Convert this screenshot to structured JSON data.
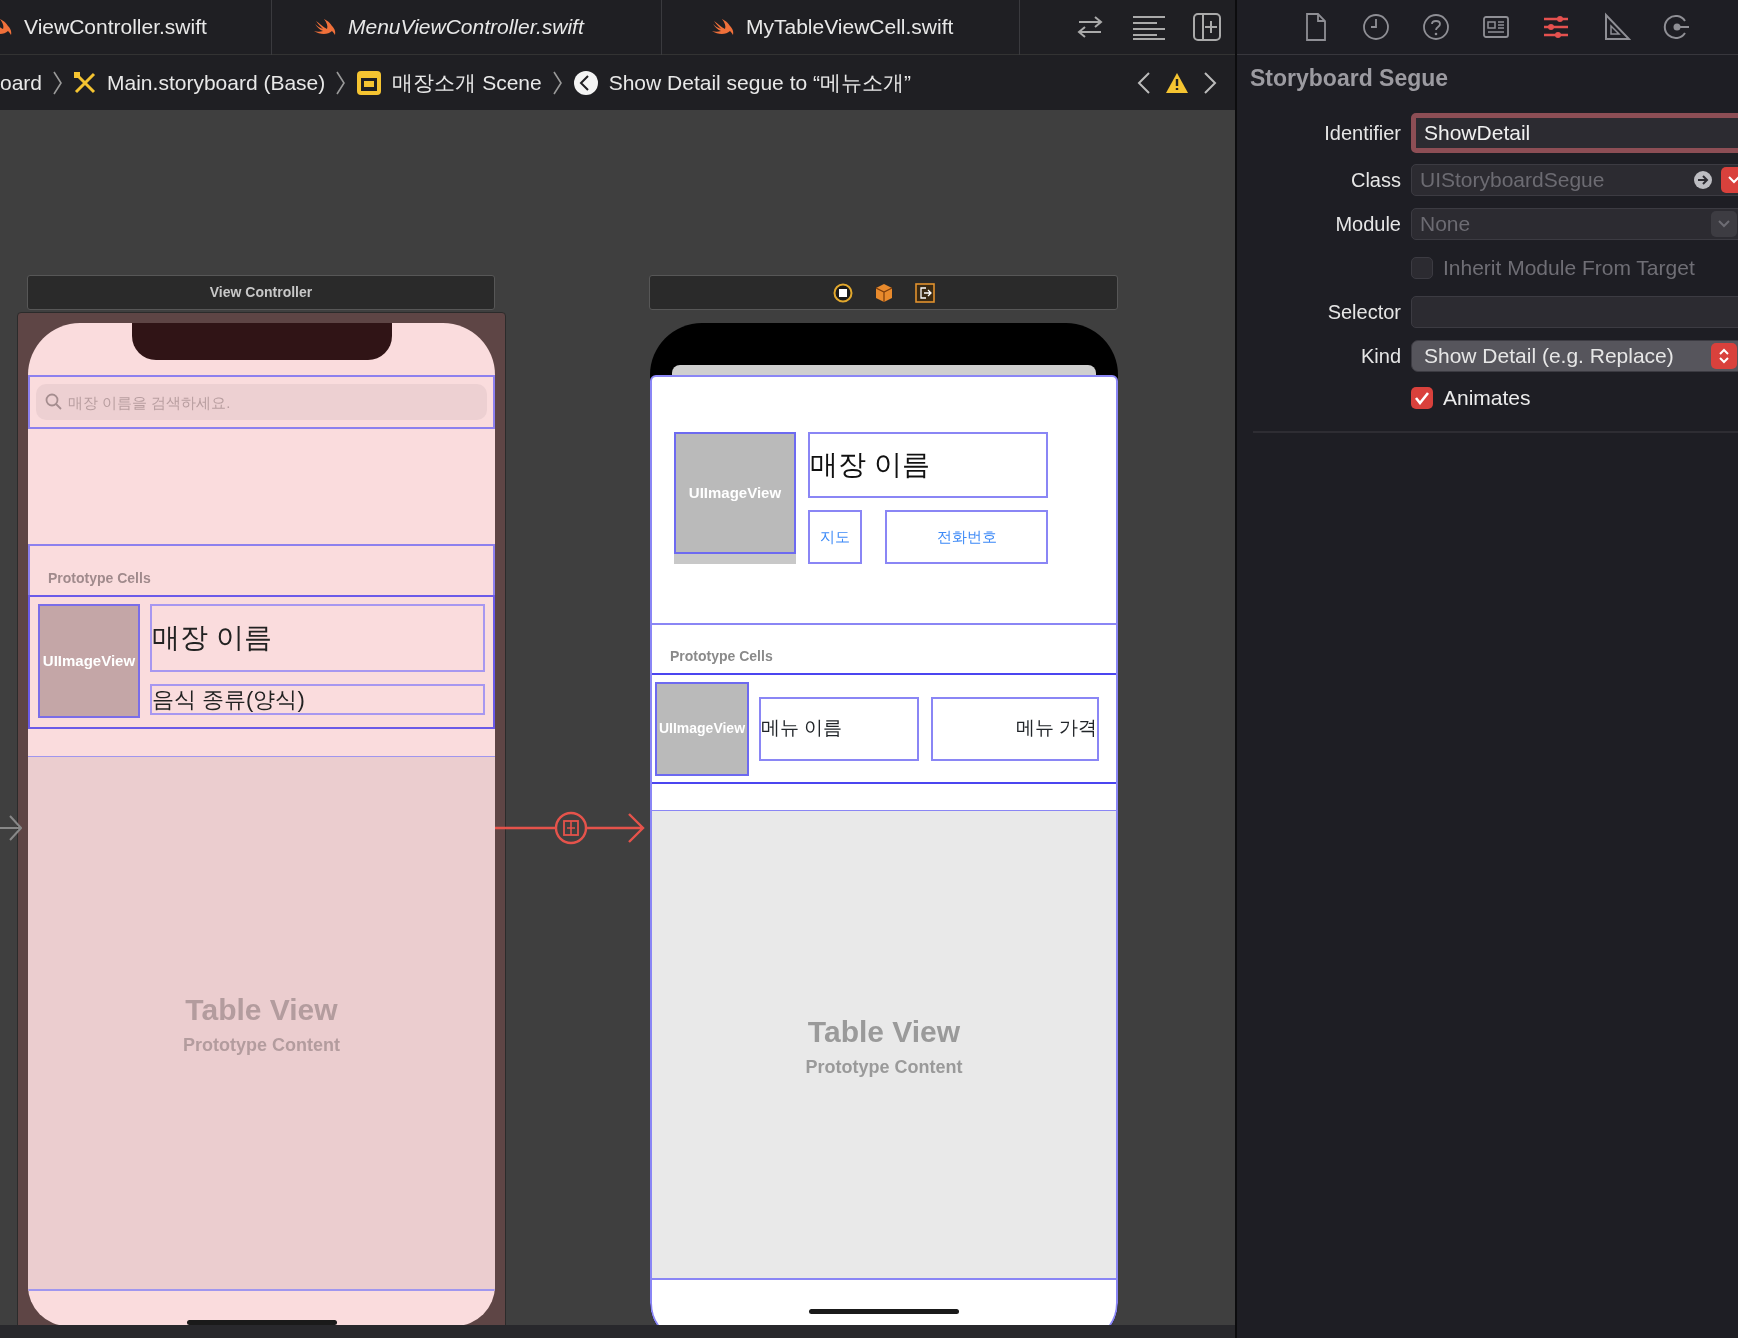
{
  "editor_tabs": [
    {
      "label": "ViewController.swift",
      "preview": false
    },
    {
      "label": "MenuViewController.swift",
      "preview": true
    },
    {
      "label": "MyTableViewCell.swift",
      "preview": false
    }
  ],
  "breadcrumb": [
    {
      "label": "oard",
      "kind": "text"
    },
    {
      "label": "Main.storyboard (Base)",
      "kind": "storyboard"
    },
    {
      "label": "매장소개 Scene",
      "kind": "scene"
    },
    {
      "label": "Show Detail segue to “메뉴소개”",
      "kind": "segue"
    }
  ],
  "scenes": [
    {
      "title": "View Controller",
      "search_placeholder": "매장 이름을 검색하세요.",
      "section_header": "Prototype Cells",
      "cell": {
        "image": "UIImageView",
        "name": "매장 이름",
        "category": "음식 종류(양식)"
      },
      "table_title": "Table View",
      "table_subtitle": "Prototype Content"
    },
    {
      "header": {
        "image": "UIImageView",
        "name": "매장 이름",
        "buttons": [
          "지도",
          "전화번호"
        ]
      },
      "section_header": "Prototype Cells",
      "cell": {
        "image": "UIImageView",
        "name": "메뉴 이름",
        "price": "메뉴 가격"
      },
      "table_title": "Table View",
      "table_subtitle": "Prototype Content"
    }
  ],
  "inspector_tabs": [
    {
      "selected": false
    },
    {
      "selected": false
    },
    {
      "selected": false
    },
    {
      "selected": false
    },
    {
      "selected": true
    },
    {
      "selected": false
    },
    {
      "selected": false
    }
  ],
  "inspector": {
    "title": "Storyboard Segue",
    "identifier": {
      "label": "Identifier",
      "value": "ShowDetail",
      "focused": true
    },
    "class": {
      "label": "Class",
      "placeholder": "UIStoryboardSegue"
    },
    "module": {
      "label": "Module",
      "placeholder": "None"
    },
    "inherit_module": {
      "label": "Inherit Module From Target",
      "checked": false,
      "disabled": true
    },
    "selector": {
      "label": "Selector"
    },
    "kind": {
      "label": "Kind",
      "value": "Show Detail (e.g. Replace)"
    },
    "animates": {
      "label": "Animates",
      "checked": true
    }
  }
}
